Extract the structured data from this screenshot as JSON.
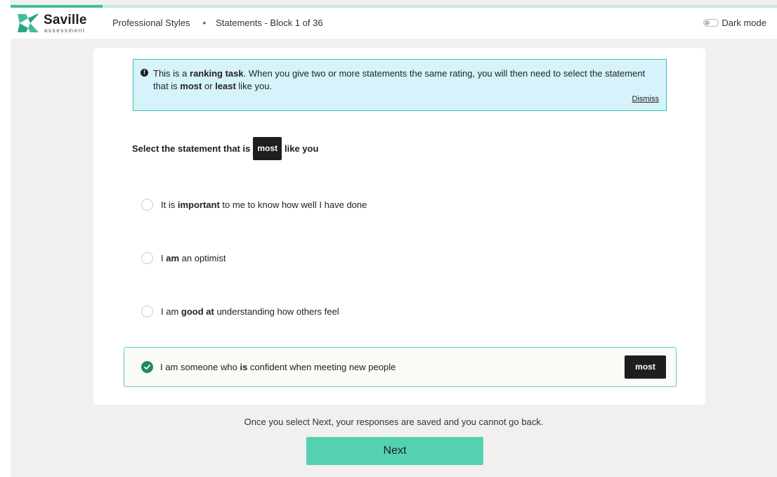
{
  "progress": {
    "fraction": 0.12
  },
  "header": {
    "logo_name": "Saville",
    "logo_sub": "assessment",
    "product": "Professional Styles",
    "separator": "•",
    "section": "Statements - Block 1 of 36",
    "dark_mode_label": "Dark mode"
  },
  "info": {
    "text_1": "This is a ",
    "bold_1": "ranking task",
    "text_2": ". When you give two or more statements the same rating, you will then need to select the statement that is ",
    "bold_2": "most",
    "text_3": " or ",
    "bold_3": "least",
    "text_4": " like you.",
    "dismiss": "Dismiss"
  },
  "question": {
    "before": "Select the statement that is",
    "pill": "most",
    "after": "like you"
  },
  "options": [
    {
      "pre": "It is ",
      "bold": "important",
      "post": " to me to know how well I have done"
    },
    {
      "pre": "I ",
      "bold": "am",
      "post": " an optimist"
    },
    {
      "pre": "I am ",
      "bold": "good at",
      "post": " understanding how others feel"
    }
  ],
  "selected_option": {
    "pre": "I am someone who ",
    "bold": "is",
    "post": " confident when meeting new people",
    "badge": "most"
  },
  "footer_note": "Once you select Next, your responses are saved and you cannot go back.",
  "next_label": "Next",
  "colors": {
    "accent": "#3fbf9b",
    "button": "#55d1b1",
    "info_bg": "#d6f3fb",
    "check": "#1f8a64"
  }
}
